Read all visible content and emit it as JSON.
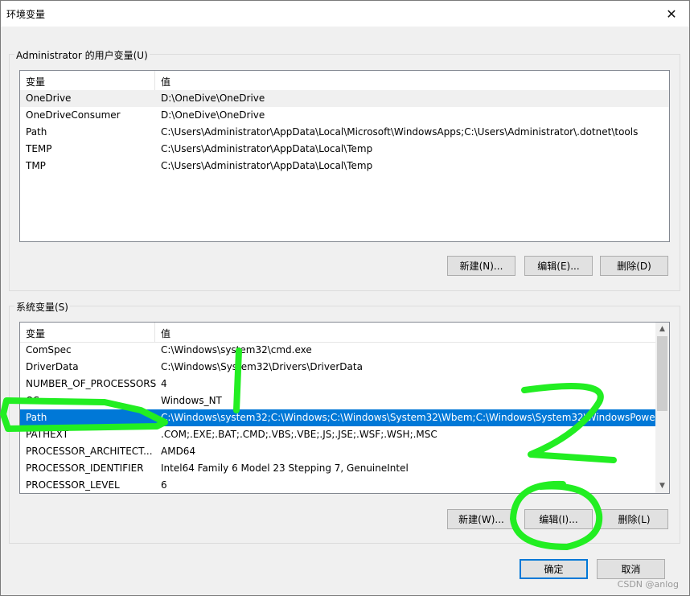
{
  "window": {
    "title": "环境变量",
    "close_label": "✕"
  },
  "user_vars": {
    "group_label": "Administrator 的用户变量(U)",
    "columns": [
      "变量",
      "值"
    ],
    "rows": [
      {
        "name": "OneDrive",
        "value": "D:\\OneDive\\OneDrive"
      },
      {
        "name": "OneDriveConsumer",
        "value": "D:\\OneDive\\OneDrive"
      },
      {
        "name": "Path",
        "value": "C:\\Users\\Administrator\\AppData\\Local\\Microsoft\\WindowsApps;C:\\Users\\Administrator\\.dotnet\\tools"
      },
      {
        "name": "TEMP",
        "value": "C:\\Users\\Administrator\\AppData\\Local\\Temp"
      },
      {
        "name": "TMP",
        "value": "C:\\Users\\Administrator\\AppData\\Local\\Temp"
      }
    ],
    "buttons": {
      "new": "新建(N)...",
      "edit": "编辑(E)...",
      "delete": "删除(D)"
    }
  },
  "system_vars": {
    "group_label": "系统变量(S)",
    "columns": [
      "变量",
      "值"
    ],
    "rows": [
      {
        "name": "ComSpec",
        "value": "C:\\Windows\\system32\\cmd.exe"
      },
      {
        "name": "DriverData",
        "value": "C:\\Windows\\System32\\Drivers\\DriverData"
      },
      {
        "name": "NUMBER_OF_PROCESSORS",
        "value": "4"
      },
      {
        "name": "OS",
        "value": "Windows_NT"
      },
      {
        "name": "Path",
        "value": "C:\\Windows\\system32;C:\\Windows;C:\\Windows\\System32\\Wbem;C:\\Windows\\System32\\WindowsPowe..."
      },
      {
        "name": "PATHEXT",
        "value": ".COM;.EXE;.BAT;.CMD;.VBS;.VBE;.JS;.JSE;.WSF;.WSH;.MSC"
      },
      {
        "name": "PROCESSOR_ARCHITECT...",
        "value": "AMD64"
      },
      {
        "name": "PROCESSOR_IDENTIFIER",
        "value": "Intel64 Family 6 Model 23 Stepping 7, GenuineIntel"
      },
      {
        "name": "PROCESSOR_LEVEL",
        "value": "6"
      }
    ],
    "selected_index": 4,
    "buttons": {
      "new": "新建(W)...",
      "edit": "编辑(I)...",
      "delete": "删除(L)"
    }
  },
  "footer": {
    "ok": "确定",
    "cancel": "取消"
  },
  "annotations": {
    "marker_1": "1",
    "marker_2": "2",
    "color": "#22ee22"
  },
  "watermark": "CSDN @anlog"
}
